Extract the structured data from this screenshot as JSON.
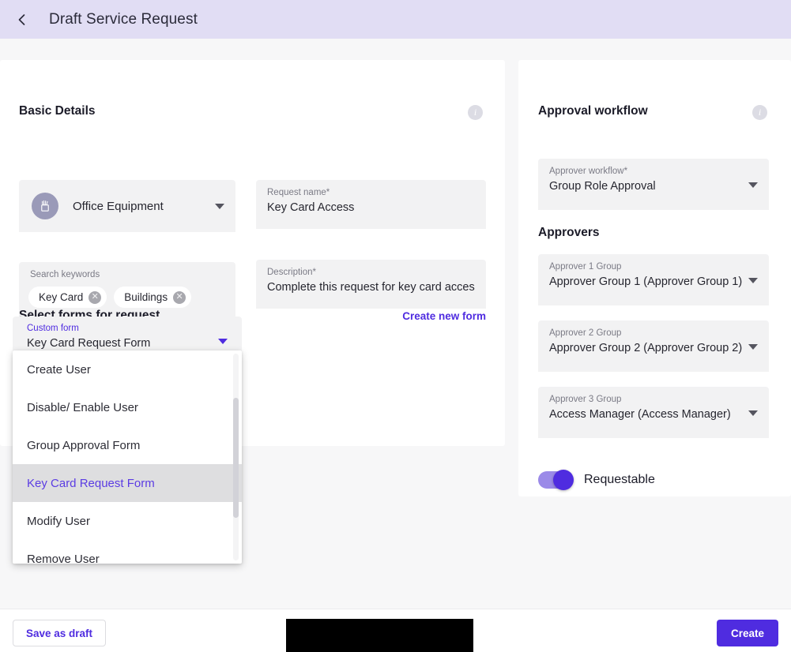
{
  "header": {
    "title": "Draft Service Request",
    "back_icon": "chevron-left-icon"
  },
  "basic_details": {
    "title": "Basic Details",
    "info_icon": "info-icon",
    "category": {
      "avatar_icon": "pen-cup-icon",
      "value": "Office Equipment",
      "caret_icon": "chevron-down-icon"
    },
    "request_name": {
      "label": "Request name*",
      "value": "Key Card Access"
    },
    "search_keywords": {
      "label": "Search keywords",
      "chips": [
        {
          "label": "Key Card",
          "remove_icon": "close-circle-icon"
        },
        {
          "label": "Buildings",
          "remove_icon": "close-circle-icon"
        }
      ]
    },
    "description": {
      "label": "Description*",
      "value": "Complete this request for key card access."
    }
  },
  "select_forms": {
    "title": "Select forms for request",
    "create_new_form_link": "Create new form",
    "custom_form": {
      "label": "Custom form",
      "value": "Key Card Request Form",
      "caret_icon": "chevron-down-icon"
    },
    "dropdown": {
      "selected": "Key Card Request Form",
      "options": [
        "Create User",
        "Disable/ Enable User",
        "Group Approval Form",
        "Key Card Request Form",
        "Modify User",
        "Remove User"
      ]
    }
  },
  "approval_workflow": {
    "title": "Approval workflow",
    "info_icon": "info-icon",
    "workflow": {
      "label": "Approver workflow*",
      "value": "Group Role Approval",
      "caret_icon": "chevron-down-icon"
    },
    "approvers_title": "Approvers",
    "approvers": [
      {
        "label": "Approver 1 Group",
        "value": "Approver Group 1 (Approver Group 1)",
        "caret_icon": "chevron-down-icon"
      },
      {
        "label": "Approver 2 Group",
        "value": "Approver Group 2 (Approver Group 2)",
        "caret_icon": "chevron-down-icon"
      },
      {
        "label": "Approver 3 Group",
        "value": "Access Manager (Access Manager)",
        "caret_icon": "chevron-down-icon"
      }
    ],
    "requestable": {
      "label": "Requestable",
      "state": "on"
    }
  },
  "footer": {
    "save_draft_label": "Save as draft",
    "create_label": "Create"
  },
  "colors": {
    "header_bg": "#e1ddf4",
    "accent": "#4f2ce0",
    "field_bg": "#f2f2f3",
    "page_bg": "#f7f7f8",
    "toggle_track": "#9b8ae8",
    "avatar_bg": "#9a9ab8"
  }
}
